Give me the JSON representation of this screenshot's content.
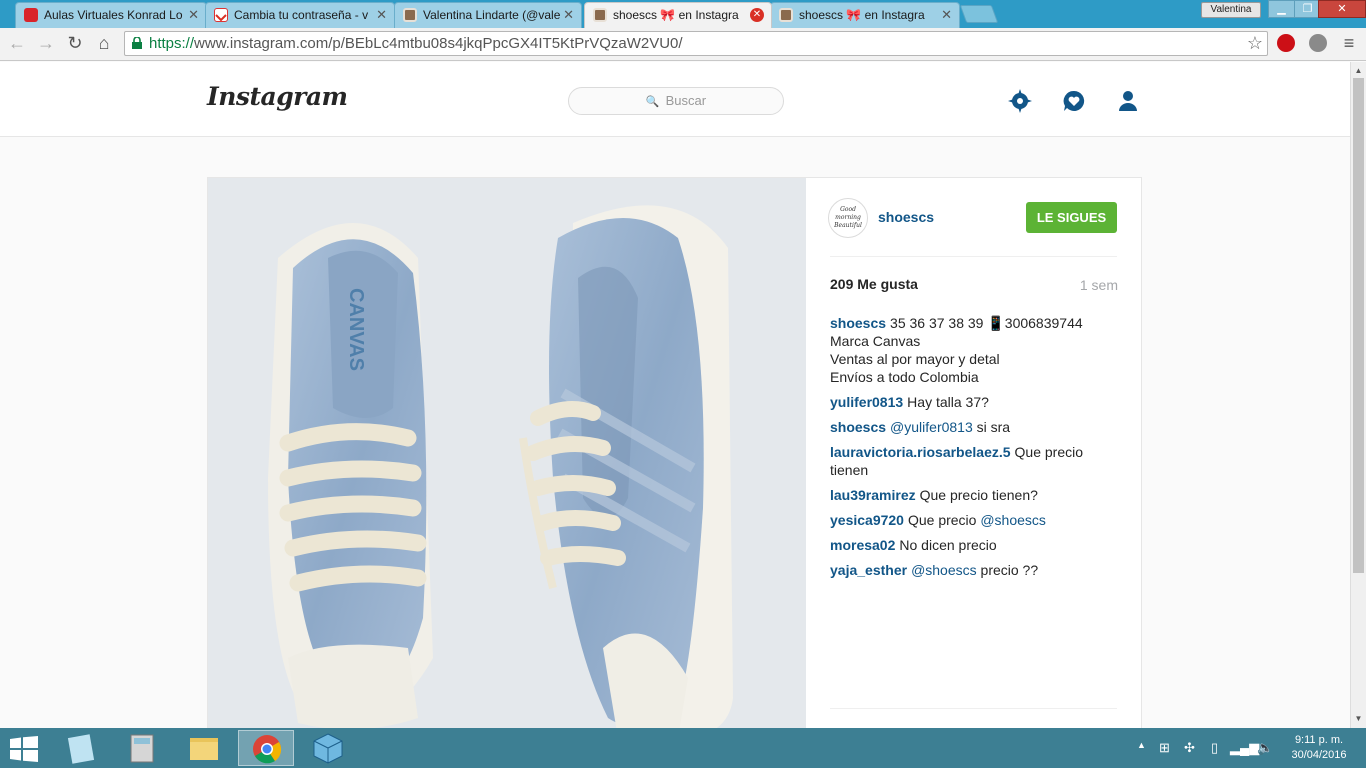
{
  "browser": {
    "tabs": [
      {
        "title": "Aulas Virtuales Konrad Lo",
        "icon": "moodle-icon"
      },
      {
        "title": "Cambia tu contraseña - v",
        "icon": "gmail-icon"
      },
      {
        "title": "Valentina Lindarte (@vale",
        "icon": "instagram-icon"
      },
      {
        "title": "shoescs 🎀 en Instagra",
        "icon": "instagram-icon"
      },
      {
        "title": "shoescs 🎀 en Instagra",
        "icon": "instagram-icon"
      }
    ],
    "user_badge": "Valentina",
    "url_https": "https://",
    "url_rest": "www.instagram.com/p/BEbLc4mtbu08s4jkqPpcGX4IT5KtPrVQzaW2VU0/"
  },
  "instagram": {
    "logo": "Instagram",
    "search_placeholder": "Buscar"
  },
  "post": {
    "owner": "shoescs",
    "avatar_text": "Good morning Beautiful",
    "follow_label": "LE SIGUES",
    "likes": "209 Me gusta",
    "time": "1 sem",
    "caption": {
      "user": "shoescs",
      "lines": [
        "35 36 37 38 39 📱3006839744",
        "Marca Canvas",
        "Ventas al por mayor y detal",
        "Envíos a todo Colombia"
      ]
    },
    "comments": [
      {
        "user": "yulifer0813",
        "text": "Hay talla 37?"
      },
      {
        "user": "shoescs",
        "mention": "@yulifer0813",
        "text": " si sra"
      },
      {
        "user": "lauravictoria.riosarbelaez.5",
        "text": "Que precio tienen"
      },
      {
        "user": "lau39ramirez",
        "text": "Que precio tienen?"
      },
      {
        "user": "yesica9720",
        "text": "Que precio ",
        "mention_after": "@shoescs"
      },
      {
        "user": "moresa02",
        "text": "No dicen precio"
      },
      {
        "user": "yaja_esther",
        "mention": "@shoescs",
        "text": " precio ??"
      }
    ],
    "shoe_brand_text": "CANVAS"
  },
  "taskbar": {
    "time": "9:11 p. m.",
    "date": "30/04/2016"
  },
  "colors": {
    "ig_link": "#125688",
    "follow_green": "#5cb335",
    "taskbar": "#3d7f93",
    "tabstrip": "#2e9bc6"
  }
}
